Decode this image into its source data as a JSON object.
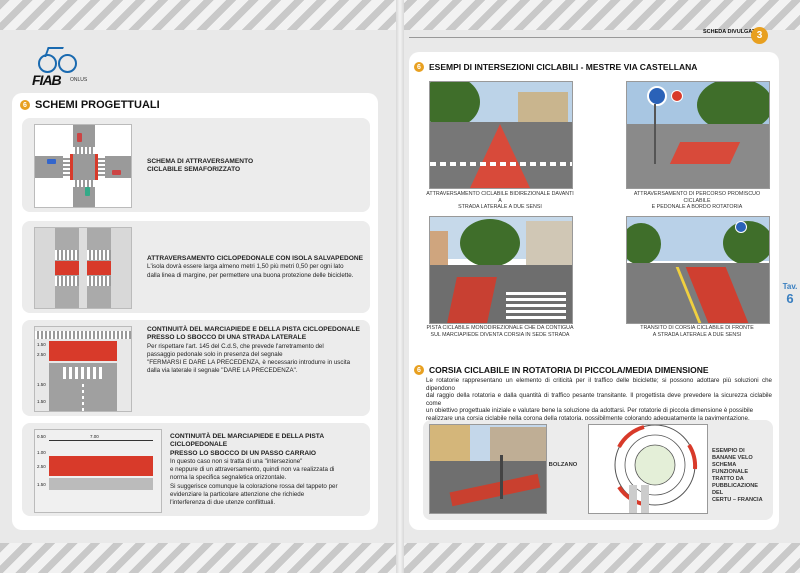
{
  "left_page": {
    "logo": {
      "mark": "FIAB",
      "sub": "ONLUS"
    },
    "section_number": "6",
    "section_title": "SCHEMI PROGETTUALI",
    "schemes": [
      {
        "title_lines": [
          "SCHEMA DI ATTRAVERSAMENTO",
          "CICLABILE SEMAFORIZZATO"
        ],
        "body_lines": []
      },
      {
        "title_lines": [
          "ATTRAVERSAMENTO CICLOPEDONALE CON ISOLA SALVAPEDONE"
        ],
        "body_lines": [
          "L'isola dovrà essere larga almeno metri 1,50 più metri 0,50 per ogni lato",
          "dalla linea di margine, per permettere una buona protezione delle biciclette."
        ]
      },
      {
        "title_lines": [
          "CONTINUITÀ DEL MARCIAPIEDE E DELLA PISTA CICLOPEDONALE",
          "PRESSO LO SBOCCO DI UNA STRADA LATERALE"
        ],
        "body_lines": [
          "Per rispettare l'art. 145 del C.d.S, che prevede l'arretramento del",
          "passaggio pedonale solo in presenza del segnale",
          "\"FERMARSI E DARE LA PRECEDENZA, è necessario introdurre in uscita",
          "dalla via laterale il segnale \"DARE LA PRECEDENZA\"."
        ],
        "dims": [
          "1.50",
          "2.50",
          "1.50",
          "1.50"
        ]
      },
      {
        "title_lines": [
          "CONTINUITÀ DEL MARCIAPIEDE E DELLA PISTA CICLOPEDONALE",
          "PRESSO LO SBOCCO DI UN PASSO CARRAIO"
        ],
        "body_lines": [
          "In questo caso non si tratta di una \"intersezione\"",
          "e neppure di un attraversamento, quindi non va realizzata di",
          "norma la specifica segnaletica orizzontale.",
          "Si suggerisce comunque la colorazione rossa del tappeto per",
          "evidenziare la particolare attenzione che richiede",
          "l'interferenza di due utenze conflittuali."
        ],
        "dims": [
          "0.50",
          "7.00",
          "1.00",
          "2.50",
          "1.50"
        ]
      }
    ]
  },
  "right_page": {
    "header_label": "SCHEDA DIVULGATIVA",
    "header_number": "3",
    "section1": {
      "number": "6",
      "title": "ESEMPI DI INTERSEZIONI CICLABILI - MESTRE VIA CASTELLANA",
      "photos": [
        {
          "caption_lines": [
            "ATTRAVERSAMENTO CICLABILE BIDIREZIONALE DAVANTI A",
            "STRADA LATERALE A DUE SENSI"
          ]
        },
        {
          "caption_lines": [
            "ATTRAVERSAMENTO DI PERCORSO PROMISCUO CICLABILE",
            "E PEDONALE A BORDO ROTATORIA"
          ]
        },
        {
          "caption_lines": [
            "PISTA CICLABILE MONODIREZIONALE CHE DA CONTIGUA",
            "SUL MARCIAPIEDE DIVENTA CORSIA IN SEDE STRADA"
          ]
        },
        {
          "caption_lines": [
            "TRANSITO DI CORSIA CICLABILE DI FRONTE",
            "A STRADA LATERALE A DUE SENSI"
          ]
        }
      ]
    },
    "section2": {
      "number": "6",
      "title": "CORSIA CICLABILE IN ROTATORIA DI PICCOLA/MEDIA DIMENSIONE",
      "body_lines": [
        "Le rotatorie rappresentano un elemento di criticità per il traffico delle biciclette; si possono adottare più soluzioni che dipendono",
        "dal raggio della rotatoria e dalla quantità di traffico pesante transitante. Il progettista deve prevedere la sicurezza ciclabile come",
        "un obiettivo progettuale iniziale e valutare bene la soluzione da adottarsi. Per rotatorie di piccola dimensione è possibile",
        "realizzare una corsia ciclabile nella corona della rotatoria, possibilmente colorando adeguatamente la pavimentazione."
      ],
      "photo_label": "BOLZANO",
      "scheme_label_lines": [
        "ESEMPIO DI",
        "BANANE VELO",
        "SCHEMA FUNZIONALE",
        "TRATTO DA",
        "PUBBLICAZIONE DEL",
        "CERTU – FRANCIA"
      ]
    },
    "side_tab": {
      "label": "Tav.",
      "number": "6"
    }
  },
  "colors": {
    "accent_orange": "#e8a020",
    "lane_red": "#d83a2a",
    "tab_blue": "#3a7fc0"
  }
}
